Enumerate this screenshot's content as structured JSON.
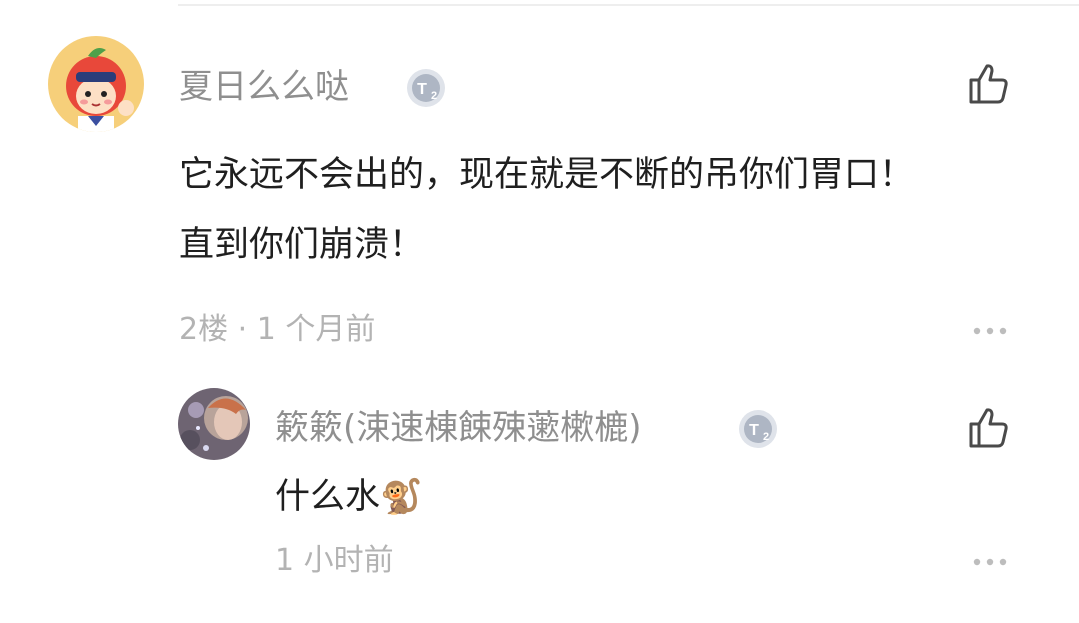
{
  "comments": [
    {
      "username": "夏日么么哒",
      "badge_icon": "t2-level-badge-icon",
      "text_lines": [
        "它永远不会出的，现在就是不断的吊你们胃口！",
        "直到你们崩溃！"
      ],
      "meta": "2楼 · 1 个月前",
      "like_icon": "thumbs-up-icon",
      "more_icon": "more-dots-icon"
    }
  ],
  "replies": [
    {
      "username": "簌簌(涑速棟餗殐藗樕樚)",
      "badge_icon": "t2-level-badge-icon",
      "text": "什么水",
      "emoji": "🐒",
      "meta": "1 小时前",
      "like_icon": "thumbs-up-icon",
      "more_icon": "more-dots-icon"
    }
  ],
  "colors": {
    "username": "#8f8f8f",
    "body_text": "#1f1f1f",
    "meta_text": "#b3b3b3",
    "icon": "#4a4a4a"
  }
}
